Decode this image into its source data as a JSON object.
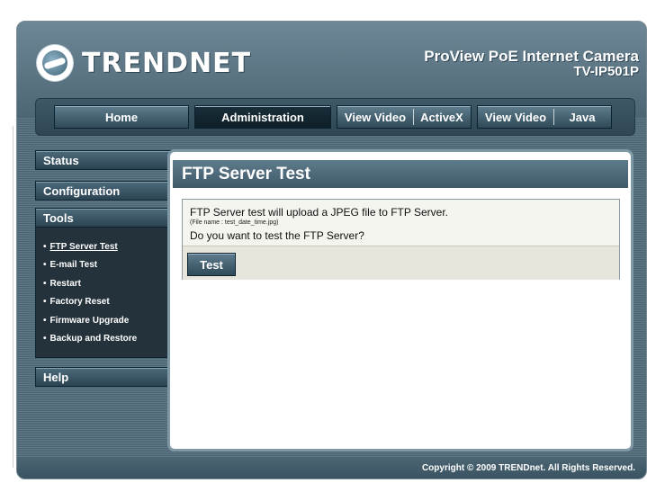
{
  "brand": {
    "logo_text": "TRENDNET",
    "product_name": "ProView PoE Internet Camera",
    "model": "TV-IP501P"
  },
  "nav": {
    "home": "Home",
    "administration": "Administration",
    "view_video_activex": {
      "left": "View Video",
      "right": "ActiveX"
    },
    "view_video_java": {
      "left": "View Video",
      "right": "Java"
    }
  },
  "sidebar": {
    "status": "Status",
    "configuration": "Configuration",
    "tools": "Tools",
    "tools_items": [
      "FTP Server Test",
      "E-mail Test",
      "Restart",
      "Factory Reset",
      "Firmware Upgrade",
      "Backup and Restore"
    ],
    "help": "Help",
    "bullet": "•"
  },
  "page": {
    "title": "FTP Server Test",
    "message": "FTP Server test will upload a JPEG file to FTP Server.",
    "file_note": "(File name : test_date_time.jpg)",
    "question": "Do you want to test the FTP Server?",
    "test_button": "Test"
  },
  "footer": {
    "copyright": "Copyright © 2009 TRENDnet. All Rights Reserved."
  },
  "colors": {
    "frame": "#4f6a78",
    "nav_dark": "#0e1f28",
    "panel_bg": "#f5f5f0"
  }
}
